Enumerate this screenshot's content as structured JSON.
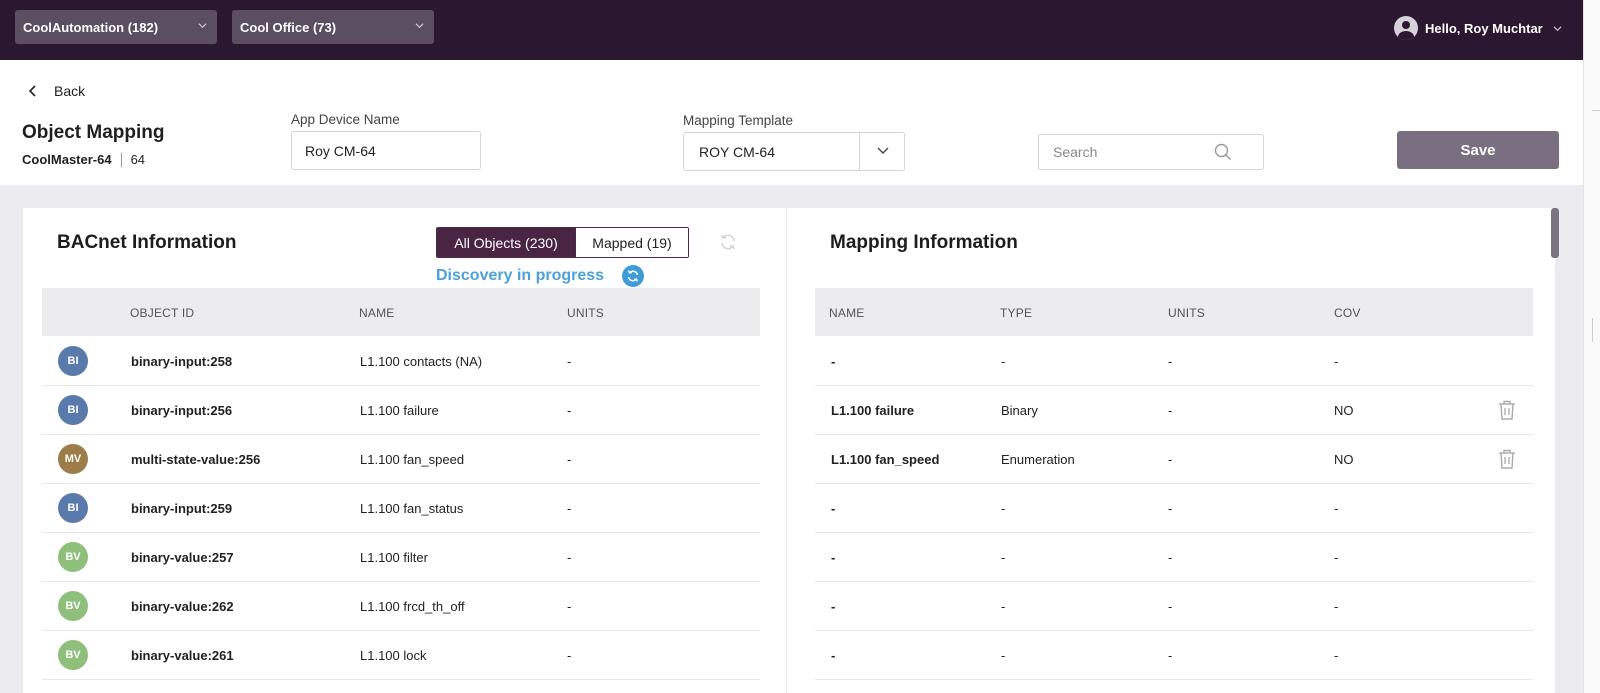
{
  "topbar": {
    "site_dropdown": "CoolAutomation (182)",
    "system_dropdown": "Cool Office (73)",
    "greeting": "Hello, Roy Muchtar"
  },
  "header": {
    "back_label": "Back",
    "title": "Object Mapping",
    "device_model": "CoolMaster-64",
    "device_number": "64",
    "app_device_name_label": "App Device Name",
    "app_device_name_value": "Roy CM-64",
    "mapping_template_label": "Mapping Template",
    "mapping_template_value": "ROY CM-64",
    "search_placeholder": "Search",
    "save_label": "Save"
  },
  "bacnet": {
    "title": "BACnet Information",
    "tab_all": "All Objects (230)",
    "tab_mapped": "Mapped (19)",
    "status": "Discovery in progress",
    "columns": [
      "OBJECT ID",
      "NAME",
      "UNITS"
    ],
    "rows": [
      {
        "badge": "BI",
        "badge_color": "#5a7aab",
        "object_id": "binary-input:258",
        "name": "L1.100 contacts (NA)",
        "units": "-"
      },
      {
        "badge": "BI",
        "badge_color": "#5a7aab",
        "object_id": "binary-input:256",
        "name": "L1.100 failure",
        "units": "-"
      },
      {
        "badge": "MV",
        "badge_color": "#9c7c47",
        "object_id": "multi-state-value:256",
        "name": "L1.100 fan_speed",
        "units": "-"
      },
      {
        "badge": "BI",
        "badge_color": "#5a7aab",
        "object_id": "binary-input:259",
        "name": "L1.100 fan_status",
        "units": "-"
      },
      {
        "badge": "BV",
        "badge_color": "#8ec07c",
        "object_id": "binary-value:257",
        "name": "L1.100 filter",
        "units": "-"
      },
      {
        "badge": "BV",
        "badge_color": "#8ec07c",
        "object_id": "binary-value:262",
        "name": "L1.100 frcd_th_off",
        "units": "-"
      },
      {
        "badge": "BV",
        "badge_color": "#8ec07c",
        "object_id": "binary-value:261",
        "name": "L1.100 lock",
        "units": "-"
      }
    ]
  },
  "mapping": {
    "title": "Mapping Information",
    "columns": [
      "NAME",
      "TYPE",
      "UNITS",
      "COV"
    ],
    "rows": [
      {
        "name": "-",
        "type": "-",
        "units": "-",
        "cov": "-",
        "deletable": false
      },
      {
        "name": "L1.100 failure",
        "type": "Binary",
        "units": "-",
        "cov": "NO",
        "deletable": true
      },
      {
        "name": "L1.100 fan_speed",
        "type": "Enumeration",
        "units": "-",
        "cov": "NO",
        "deletable": true
      },
      {
        "name": "-",
        "type": "-",
        "units": "-",
        "cov": "-",
        "deletable": false
      },
      {
        "name": "-",
        "type": "-",
        "units": "-",
        "cov": "-",
        "deletable": false
      },
      {
        "name": "-",
        "type": "-",
        "units": "-",
        "cov": "-",
        "deletable": false
      },
      {
        "name": "-",
        "type": "-",
        "units": "-",
        "cov": "-",
        "deletable": false
      }
    ]
  },
  "colors": {
    "topbar": "#29182f",
    "accent": "#4a2443",
    "save_button": "#7a6f80",
    "discovery_text": "#4da1d8"
  }
}
